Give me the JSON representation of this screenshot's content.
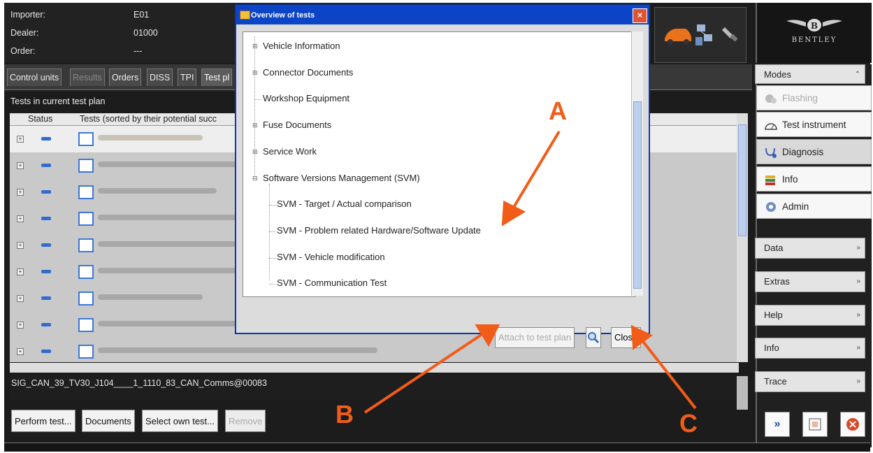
{
  "header": {
    "rows": [
      {
        "label": "Importer:",
        "value": "E01"
      },
      {
        "label": "Dealer:",
        "value": "01000"
      },
      {
        "label": "Order:",
        "value": "---"
      }
    ],
    "brand": "BENTLEY"
  },
  "tabs": [
    {
      "label": "Control units",
      "state": "normal"
    },
    {
      "label": "Results",
      "state": "dim"
    },
    {
      "label": "Orders",
      "state": "normal"
    },
    {
      "label": "DISS",
      "state": "normal"
    },
    {
      "label": "TPI",
      "state": "normal"
    },
    {
      "label": "Test pl",
      "state": "active"
    }
  ],
  "test_plan": {
    "section_label": "Tests in current test plan",
    "col_status": "Status",
    "col_tests": "Tests (sorted by their potential succ",
    "signature": "SIG_CAN_39_TV30_J104____1_1110_83_CAN_Comms@00083"
  },
  "buttons": {
    "perform": "Perform test...",
    "documents": "Documents",
    "select_own": "Select own test...",
    "remove": "Remove"
  },
  "right_panel": {
    "modes_label": "Modes",
    "modes": [
      {
        "label": "Flashing",
        "icon": "gears-icon",
        "state": "dim"
      },
      {
        "label": "Test instrument",
        "icon": "gauge-icon",
        "state": "normal"
      },
      {
        "label": "Diagnosis",
        "icon": "stethoscope-icon",
        "state": "selected"
      },
      {
        "label": "Info",
        "icon": "books-icon",
        "state": "normal"
      },
      {
        "label": "Admin",
        "icon": "admin-gear-icon",
        "state": "normal"
      }
    ],
    "sections": [
      "Data",
      "Extras",
      "Help",
      "Info",
      "Trace"
    ]
  },
  "dialog": {
    "title": "Overview of tests",
    "tree": [
      {
        "label": "Vehicle Information",
        "level": 0,
        "expander": "+"
      },
      {
        "label": "Connector Documents",
        "level": 0,
        "expander": "+"
      },
      {
        "label": "Workshop Equipment",
        "level": 0,
        "expander": ""
      },
      {
        "label": "Fuse Documents",
        "level": 0,
        "expander": "+"
      },
      {
        "label": "Service Work",
        "level": 0,
        "expander": "+"
      },
      {
        "label": "Software Versions Management (SVM)",
        "level": 0,
        "expander": "-"
      },
      {
        "label": "SVM - Target / Actual comparison",
        "level": 1,
        "expander": ""
      },
      {
        "label": "SVM - Problem related Hardware/Software Update",
        "level": 1,
        "expander": ""
      },
      {
        "label": "SVM - Vehicle modification",
        "level": 1,
        "expander": ""
      },
      {
        "label": "SVM - Communication Test",
        "level": 1,
        "expander": ""
      }
    ],
    "attach_label": "Attach to test plan",
    "close_label": "Close"
  },
  "annotations": [
    "A",
    "B",
    "C"
  ],
  "colors": {
    "annotation": "#f25c19",
    "dialog_title_bar": "#0c44c8"
  }
}
